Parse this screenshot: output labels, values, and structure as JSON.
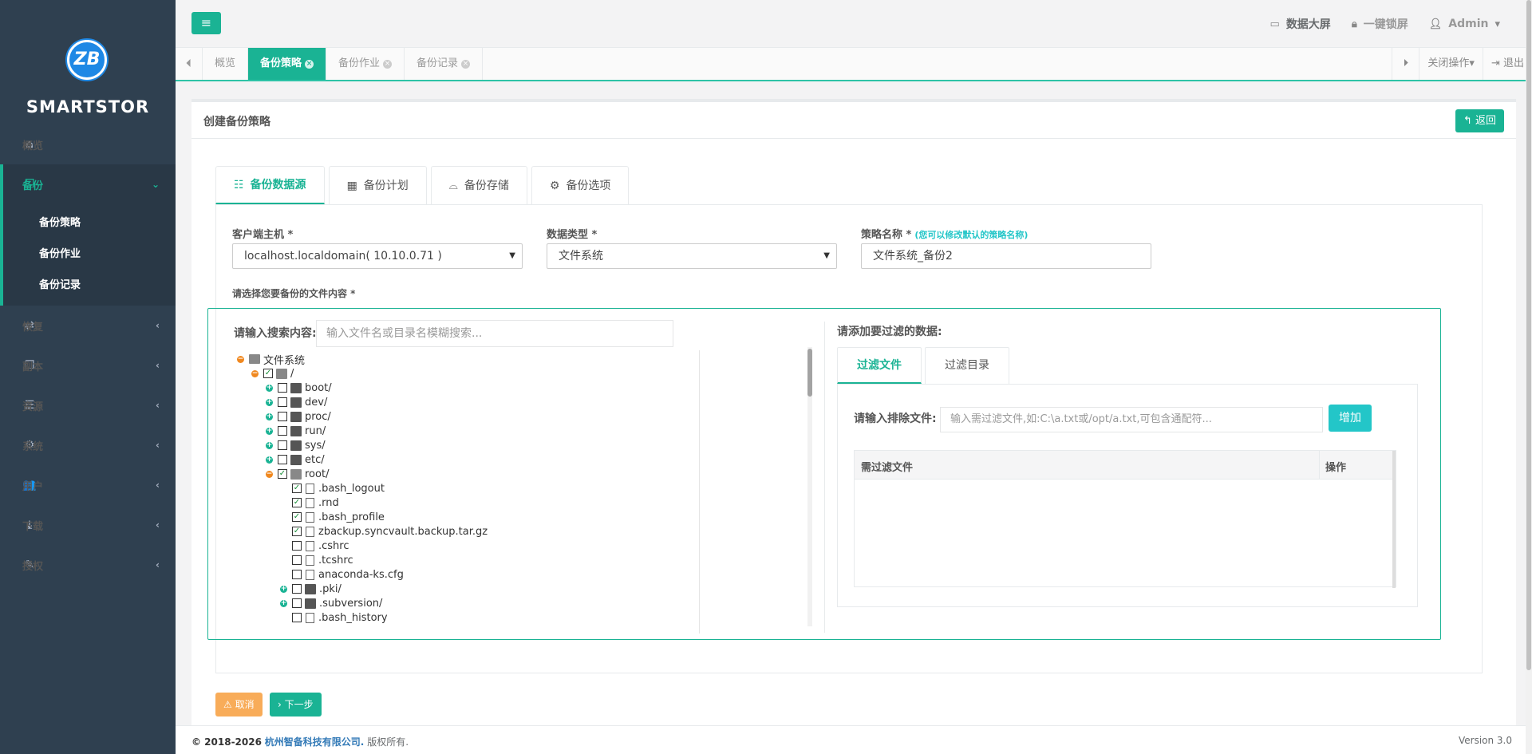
{
  "brand": {
    "logo_text": "ZB",
    "name": "SMARTSTOR"
  },
  "sidebar": {
    "items": [
      {
        "label": "概览",
        "icon": "home-icon",
        "glyph": "⌂"
      },
      {
        "label": "备份",
        "icon": "cube-icon",
        "glyph": "❒"
      },
      {
        "label": "恢复",
        "icon": "retweet-icon",
        "glyph": "⇄"
      },
      {
        "label": "副本",
        "icon": "copy-icon",
        "glyph": "❐"
      },
      {
        "label": "资源",
        "icon": "server-icon",
        "glyph": "☰"
      },
      {
        "label": "系统",
        "icon": "gears-icon",
        "glyph": "⚙"
      },
      {
        "label": "用户",
        "icon": "users-icon",
        "glyph": "👥"
      },
      {
        "label": "下载",
        "icon": "download-icon",
        "glyph": "⤓"
      },
      {
        "label": "授权",
        "icon": "edit-icon",
        "glyph": "✎"
      }
    ],
    "backup_sub": [
      "备份策略",
      "备份作业",
      "备份记录"
    ]
  },
  "topbar": {
    "dashboard": "数据大屏",
    "lock": "一键锁屏",
    "user": "Admin"
  },
  "page_tabs": {
    "items": [
      "概览",
      "备份策略",
      "备份作业",
      "备份记录"
    ],
    "close_ops": "关闭操作",
    "logout": "退出"
  },
  "panel": {
    "title": "创建备份策略",
    "back": "返回"
  },
  "steps": [
    "备份数据源",
    "备份计划",
    "备份存储",
    "备份选项"
  ],
  "form": {
    "client_label": "客户端主机 *",
    "client_value": "localhost.localdomain( 10.10.0.71 )",
    "type_label": "数据类型 *",
    "type_value": "文件系统",
    "name_label": "策略名称 *",
    "name_hint": "(您可以修改默认的策略名称)",
    "name_value": "文件系统_备份2",
    "content_label": "请选择您要备份的文件内容 *"
  },
  "tree": {
    "search_label": "请输入搜索内容:",
    "search_placeholder": "输入文件名或目录名模糊搜索...",
    "nodes": [
      {
        "label": "文件系统",
        "depth": 0,
        "toggle": "minus",
        "kind": "root",
        "checked": null
      },
      {
        "label": "/",
        "depth": 1,
        "toggle": "minus",
        "kind": "folder-open",
        "checked": true
      },
      {
        "label": "boot/",
        "depth": 2,
        "toggle": "plus",
        "kind": "folder",
        "checked": false
      },
      {
        "label": "dev/",
        "depth": 2,
        "toggle": "plus",
        "kind": "folder",
        "checked": false
      },
      {
        "label": "proc/",
        "depth": 2,
        "toggle": "plus",
        "kind": "folder",
        "checked": false
      },
      {
        "label": "run/",
        "depth": 2,
        "toggle": "plus",
        "kind": "folder",
        "checked": false
      },
      {
        "label": "sys/",
        "depth": 2,
        "toggle": "plus",
        "kind": "folder",
        "checked": false
      },
      {
        "label": "etc/",
        "depth": 2,
        "toggle": "plus",
        "kind": "folder",
        "checked": false
      },
      {
        "label": "root/",
        "depth": 2,
        "toggle": "minus",
        "kind": "folder-open",
        "checked": true
      },
      {
        "label": ".bash_logout",
        "depth": 3,
        "toggle": "none",
        "kind": "file",
        "checked": true
      },
      {
        "label": ".rnd",
        "depth": 3,
        "toggle": "none",
        "kind": "file",
        "checked": true
      },
      {
        "label": ".bash_profile",
        "depth": 3,
        "toggle": "none",
        "kind": "file",
        "checked": true
      },
      {
        "label": "zbackup.syncvault.backup.tar.gz",
        "depth": 3,
        "toggle": "none",
        "kind": "file",
        "checked": true
      },
      {
        "label": ".cshrc",
        "depth": 3,
        "toggle": "none",
        "kind": "file",
        "checked": false
      },
      {
        "label": ".tcshrc",
        "depth": 3,
        "toggle": "none",
        "kind": "file",
        "checked": false
      },
      {
        "label": "anaconda-ks.cfg",
        "depth": 3,
        "toggle": "none",
        "kind": "file",
        "checked": false
      },
      {
        "label": ".pki/",
        "depth": 3,
        "toggle": "plus",
        "kind": "folder",
        "checked": false
      },
      {
        "label": ".subversion/",
        "depth": 3,
        "toggle": "plus",
        "kind": "folder",
        "checked": false
      },
      {
        "label": ".bash_history",
        "depth": 3,
        "toggle": "none",
        "kind": "file",
        "checked": false
      }
    ]
  },
  "filter": {
    "title": "请添加要过滤的数据:",
    "tabs": [
      "过滤文件",
      "过滤目录"
    ],
    "exclude_label": "请输入排除文件:",
    "exclude_placeholder": "输入需过滤文件,如:C:\\a.txt或/opt/a.txt,可包含通配符...",
    "add": "增加",
    "col_file": "需过滤文件",
    "col_op": "操作"
  },
  "buttons": {
    "cancel": "取消",
    "next": "下一步"
  },
  "footer": {
    "copyright": "© 2018-2026",
    "company": "杭州智备科技有限公司.",
    "rights": "版权所有.",
    "version": "Version 3.0"
  },
  "colors": {
    "accent": "#1ab394",
    "sidebar": "#2f4050",
    "info": "#23c6c8",
    "warning": "#f8ac59"
  }
}
